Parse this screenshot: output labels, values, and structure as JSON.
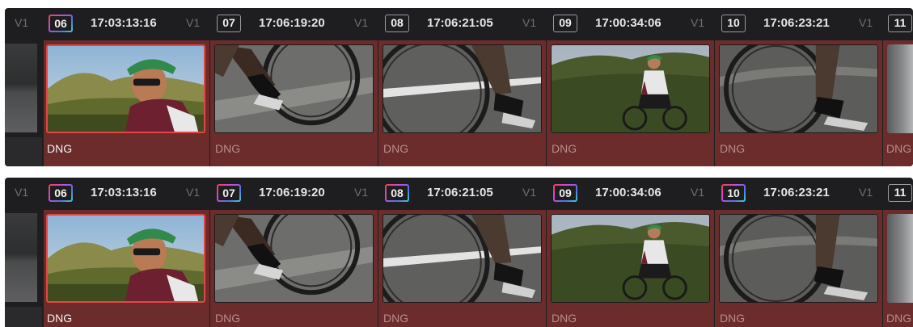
{
  "strips": [
    {
      "id": "strip-1",
      "lead_track": "V1",
      "clips": [
        {
          "number": "06",
          "timecode": "17:03:13:16",
          "track": "V1",
          "format": "DNG",
          "badge_style": "gradient",
          "selected": true,
          "scene": "portrait"
        },
        {
          "number": "07",
          "timecode": "17:06:19:20",
          "track": "V1",
          "format": "DNG",
          "badge_style": "plain",
          "selected": false,
          "scene": "pedal"
        },
        {
          "number": "08",
          "timecode": "17:06:21:05",
          "track": "V1",
          "format": "DNG",
          "badge_style": "plain",
          "selected": false,
          "scene": "road"
        },
        {
          "number": "09",
          "timecode": "17:00:34:06",
          "track": "V1",
          "format": "DNG",
          "badge_style": "plain",
          "selected": false,
          "scene": "rider"
        },
        {
          "number": "10",
          "timecode": "17:06:23:21",
          "track": "V1",
          "format": "DNG",
          "badge_style": "plain",
          "selected": false,
          "scene": "wheel"
        }
      ],
      "tail": {
        "number": "11",
        "format": "DNG"
      }
    },
    {
      "id": "strip-2",
      "lead_track": "V1",
      "clips": [
        {
          "number": "06",
          "timecode": "17:03:13:16",
          "track": "V1",
          "format": "DNG",
          "badge_style": "gradient",
          "selected": true,
          "scene": "portrait"
        },
        {
          "number": "07",
          "timecode": "17:06:19:20",
          "track": "V1",
          "format": "DNG",
          "badge_style": "gradient",
          "selected": false,
          "scene": "pedal"
        },
        {
          "number": "08",
          "timecode": "17:06:21:05",
          "track": "V1",
          "format": "DNG",
          "badge_style": "gradient",
          "selected": false,
          "scene": "road"
        },
        {
          "number": "09",
          "timecode": "17:00:34:06",
          "track": "V1",
          "format": "DNG",
          "badge_style": "gradient",
          "selected": false,
          "scene": "rider"
        },
        {
          "number": "10",
          "timecode": "17:06:23:21",
          "track": "V1",
          "format": "DNG",
          "badge_style": "gradient",
          "selected": false,
          "scene": "wheel"
        }
      ],
      "tail": {
        "number": "11",
        "format": "DNG"
      }
    }
  ],
  "colors": {
    "strip_bg": "#1e1e20",
    "clip_bg": "#6b2c2b",
    "selection": "#e04848",
    "label_dim": "#b78d8c",
    "label_active": "#f2f2f2"
  }
}
